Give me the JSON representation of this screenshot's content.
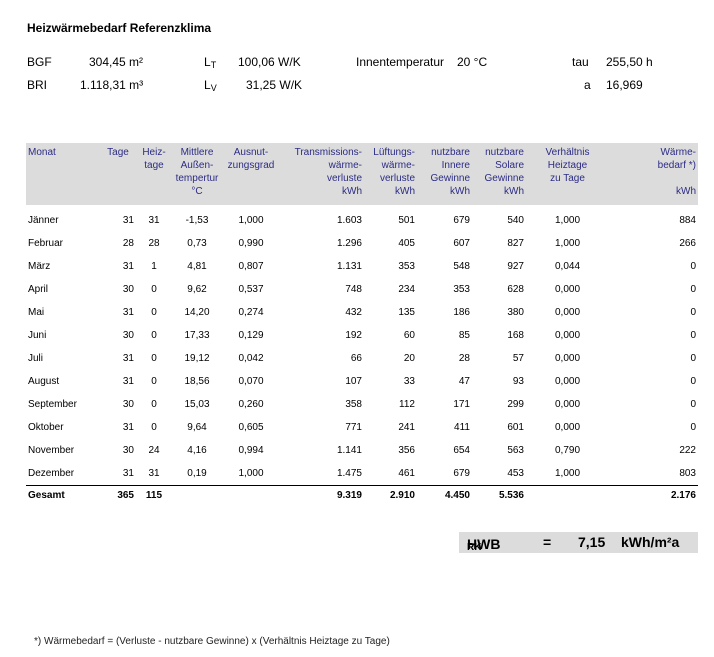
{
  "title": "Heizwärmebedarf Referenzklima",
  "params": {
    "bgf_label": "BGF",
    "bgf_value": "304,45 m²",
    "bri_label": "BRI",
    "bri_value": "1.118,31 m³",
    "lt_main": "L",
    "lt_sub": "T",
    "lt_value": "100,06 W/K",
    "lv_main": "L",
    "lv_sub": "V",
    "lv_value": "31,25 W/K",
    "innen_label": "Innentemperatur",
    "innen_value": "20 °C",
    "tau_label": "tau",
    "tau_value": "255,50 h",
    "a_label": "a",
    "a_value": "16,969"
  },
  "table": {
    "headers": [
      [
        "Monat"
      ],
      [
        "Tage"
      ],
      [
        "Heiz-",
        "tage"
      ],
      [
        "Mittlere",
        "Außen-",
        "tempertur",
        "°C"
      ],
      [
        "Ausnut-",
        "zungsgrad"
      ],
      [
        "Transmissions-",
        "wärme-",
        "verluste",
        "kWh"
      ],
      [
        "Lüftungs-",
        "wärme-",
        "verluste",
        "kWh"
      ],
      [
        "nutzbare",
        "Innere",
        "Gewinne",
        "kWh"
      ],
      [
        "nutzbare",
        "Solare",
        "Gewinne",
        "kWh"
      ],
      [
        "Verhältnis",
        "Heiztage",
        "zu Tage"
      ],
      [
        "Wärme-",
        "bedarf *)",
        "",
        "kWh"
      ]
    ],
    "rows": [
      [
        "Jänner",
        "31",
        "31",
        "-1,53",
        "1,000",
        "1.603",
        "501",
        "679",
        "540",
        "1,000",
        "884"
      ],
      [
        "Februar",
        "28",
        "28",
        "0,73",
        "0,990",
        "1.296",
        "405",
        "607",
        "827",
        "1,000",
        "266"
      ],
      [
        "März",
        "31",
        "1",
        "4,81",
        "0,807",
        "1.131",
        "353",
        "548",
        "927",
        "0,044",
        "0"
      ],
      [
        "April",
        "30",
        "0",
        "9,62",
        "0,537",
        "748",
        "234",
        "353",
        "628",
        "0,000",
        "0"
      ],
      [
        "Mai",
        "31",
        "0",
        "14,20",
        "0,274",
        "432",
        "135",
        "186",
        "380",
        "0,000",
        "0"
      ],
      [
        "Juni",
        "30",
        "0",
        "17,33",
        "0,129",
        "192",
        "60",
        "85",
        "168",
        "0,000",
        "0"
      ],
      [
        "Juli",
        "31",
        "0",
        "19,12",
        "0,042",
        "66",
        "20",
        "28",
        "57",
        "0,000",
        "0"
      ],
      [
        "August",
        "31",
        "0",
        "18,56",
        "0,070",
        "107",
        "33",
        "47",
        "93",
        "0,000",
        "0"
      ],
      [
        "September",
        "30",
        "0",
        "15,03",
        "0,260",
        "358",
        "112",
        "171",
        "299",
        "0,000",
        "0"
      ],
      [
        "Oktober",
        "31",
        "0",
        "9,64",
        "0,605",
        "771",
        "241",
        "411",
        "601",
        "0,000",
        "0"
      ],
      [
        "November",
        "30",
        "24",
        "4,16",
        "0,994",
        "1.141",
        "356",
        "654",
        "563",
        "0,790",
        "222"
      ],
      [
        "Dezember",
        "31",
        "31",
        "0,19",
        "1,000",
        "1.475",
        "461",
        "679",
        "453",
        "1,000",
        "803"
      ]
    ],
    "total": [
      "Gesamt",
      "365",
      "115",
      "",
      "",
      "9.319",
      "2.910",
      "4.450",
      "5.536",
      "",
      "2.176"
    ]
  },
  "hwb": {
    "label_main": "HWB",
    "label_sub": "RK",
    "equals": "=",
    "value": "7,15",
    "unit": "kWh/m²a"
  },
  "footnote": "*) Wärmebedarf = (Verluste - nutzbare Gewinne) x (Verhältnis Heiztage zu Tage)",
  "colors": {
    "header_bg": "#dcdcdc",
    "header_text": "#2c2c86"
  }
}
